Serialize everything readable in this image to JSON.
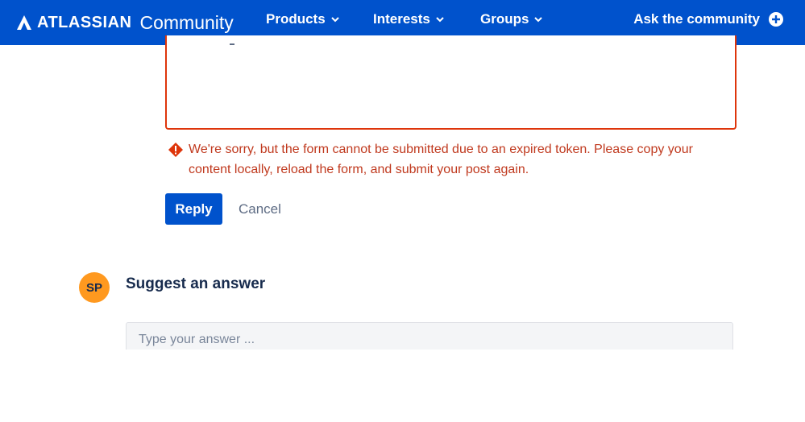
{
  "header": {
    "brand": "ATLASSIAN",
    "brand_suffix": "Community",
    "nav": [
      {
        "label": "Products",
        "icon": "chevron-down-icon"
      },
      {
        "label": "Interests",
        "icon": "chevron-down-icon"
      },
      {
        "label": "Groups",
        "icon": "chevron-down-icon"
      }
    ],
    "ask_label": "Ask the community",
    "ask_icon": "plus-circle-icon"
  },
  "reply_form": {
    "error_message": "We're sorry, but the form cannot be submitted due to an expired token. Please copy your content locally, reload the form, and submit your post again.",
    "error_icon": "warning-icon",
    "reply_label": "Reply",
    "cancel_label": "Cancel"
  },
  "suggest": {
    "avatar_initials": "SP",
    "title": "Suggest an answer",
    "placeholder": "Type your answer ..."
  },
  "colors": {
    "brand": "#0052CC",
    "error": "#DE350B",
    "avatar": "#FF991F"
  }
}
